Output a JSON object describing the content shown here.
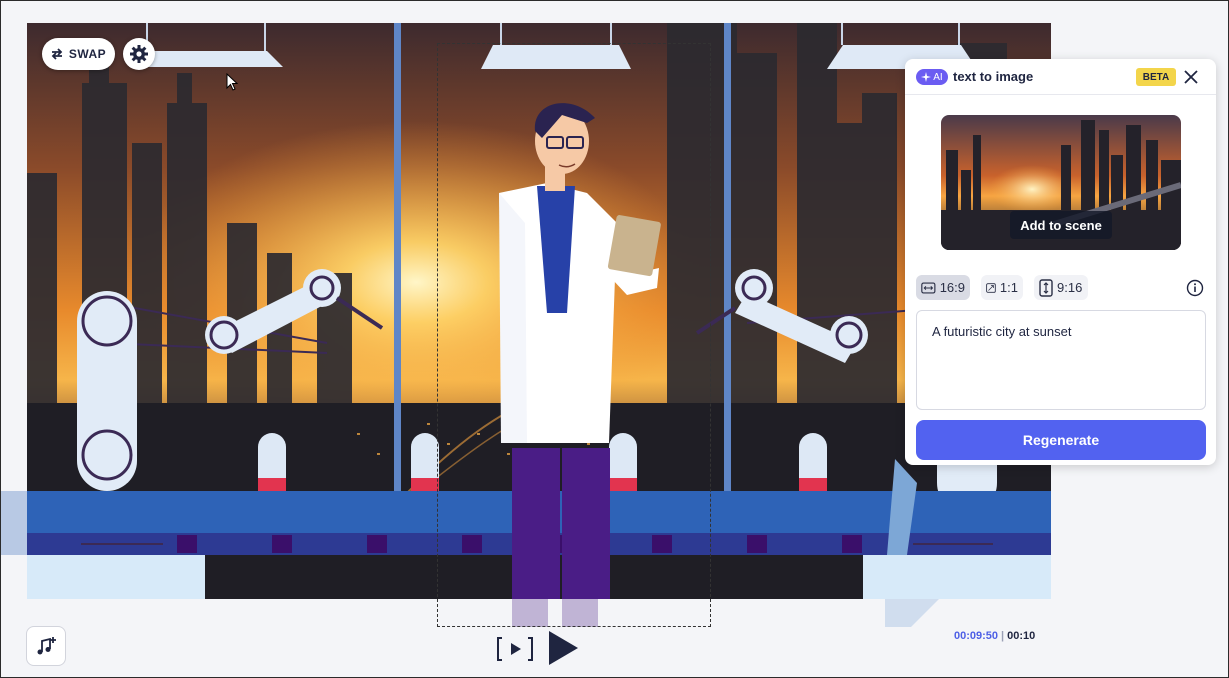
{
  "canvas": {
    "swap_label": "SWAP"
  },
  "panel": {
    "ai_badge": "AI",
    "title": "text to image",
    "beta": "BETA",
    "add_to_scene": "Add to scene",
    "ratios": [
      {
        "label": "16:9",
        "icon": "landscape-ratio-icon",
        "selected": true
      },
      {
        "label": "1:1",
        "icon": "square-ratio-icon",
        "selected": false
      },
      {
        "label": "9:16",
        "icon": "portrait-ratio-icon",
        "selected": false
      }
    ],
    "prompt_value": "A futuristic city at sunset",
    "regenerate_label": "Regenerate"
  },
  "player": {
    "current_time": "00:09:50",
    "separator": "|",
    "total_time": "00:10"
  },
  "colors": {
    "accent": "#5262f0",
    "ai_badge": "#6b5cf2",
    "beta": "#f3d54b",
    "conveyor": "#2e63b7",
    "test_tube_liquid": "#e2344f"
  }
}
